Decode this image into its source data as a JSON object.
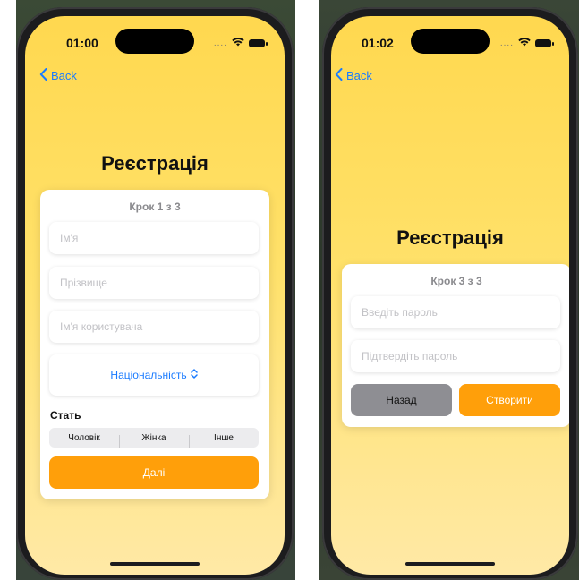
{
  "left_screen": {
    "status": {
      "time": "01:00",
      "dots": "....",
      "icons": [
        "wifi-icon",
        "battery-icon"
      ]
    },
    "back_label": "Back",
    "title": "Реєстрація",
    "step": "Крок 1 з 3",
    "fields": {
      "first_name_placeholder": "Ім'я",
      "last_name_placeholder": "Прізвище",
      "username_placeholder": "Ім'я користувача"
    },
    "nationality_label": "Національність",
    "gender_label": "Стать",
    "gender_options": [
      "Чоловік",
      "Жінка",
      "Інше"
    ],
    "next_label": "Далі"
  },
  "right_screen": {
    "status": {
      "time": "01:02",
      "dots": "....",
      "icons": [
        "wifi-icon",
        "battery-icon"
      ]
    },
    "back_label": "Back",
    "title": "Реєстрація",
    "step": "Крок 3 з 3",
    "fields": {
      "password_placeholder": "Введіть пароль",
      "confirm_placeholder": "Підтвердіть пароль"
    },
    "back_button_label": "Назад",
    "create_label": "Створити"
  },
  "colors": {
    "accent": "#ff9f0a",
    "link": "#1a7bff",
    "background_top": "#ffd84f",
    "background_bottom": "#ffe9a6"
  }
}
